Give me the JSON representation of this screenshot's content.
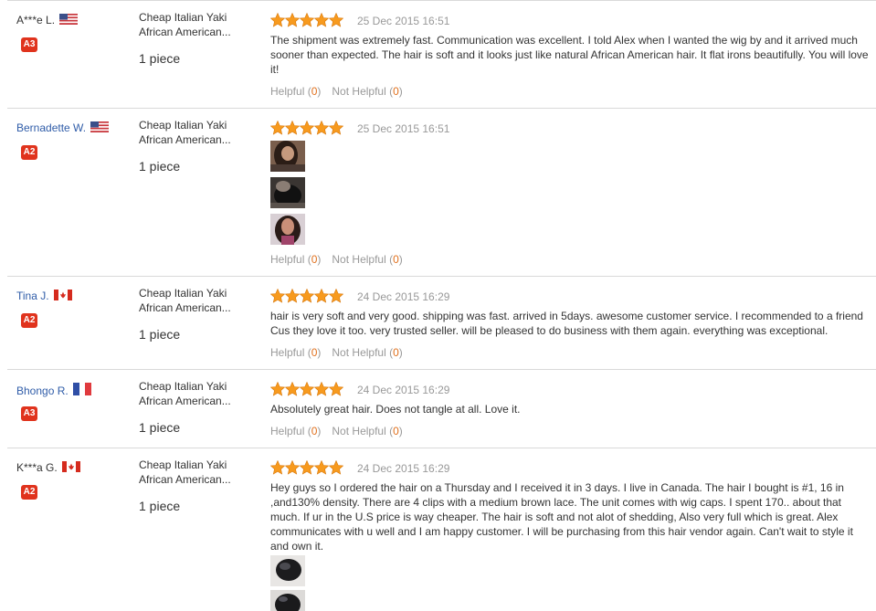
{
  "common": {
    "product_line1": "Cheap Italian Yaki",
    "product_line2": "African American...",
    "quantity": "1 piece",
    "helpful_label": "Helpful",
    "not_helpful_label": "Not Helpful",
    "star_color": "#f79a1e"
  },
  "reviews": [
    {
      "user": "A***e L.",
      "country": "US",
      "level": "A3",
      "rating": 5,
      "date": "25 Dec 2015 16:51",
      "text": "The shipment was extremely fast. Communication was excellent. I told Alex when I wanted the wig by and it arrived much sooner than expected. The hair is soft and it looks just like natural African American hair. It flat irons beautifully. You will love it!",
      "helpful": "0",
      "not_helpful": "0"
    },
    {
      "user": "Bernadette W.",
      "country": "US",
      "level": "A2",
      "rating": 5,
      "date": "25 Dec 2015 16:51",
      "text": "",
      "helpful": "0",
      "not_helpful": "0"
    },
    {
      "user": "Tina J.",
      "country": "CA",
      "level": "A2",
      "rating": 5,
      "date": "24 Dec 2015 16:29",
      "text": "hair is very soft and very good. shipping was fast. arrived in 5days. awesome customer service. I recommended to a friend Cus they love it too. very trusted seller. will be pleased to do business with them again. everything was exceptional.",
      "helpful": "0",
      "not_helpful": "0"
    },
    {
      "user": "Bhongo R.",
      "country": "FR",
      "level": "A3",
      "rating": 5,
      "date": "24 Dec 2015 16:29",
      "text": "Absolutely great hair. Does not tangle at all. Love it.",
      "helpful": "0",
      "not_helpful": "0"
    },
    {
      "user": "K***a G.",
      "country": "CA",
      "level": "A2",
      "rating": 5,
      "date": "24 Dec 2015 16:29",
      "text": "Hey guys so I ordered the hair on a Thursday and I received it in 3 days. I live in Canada. The hair I bought is #1, 16 in ,and130% density. There are 4 clips with a medium brown lace. The unit comes with wig caps. I spent 170.. about that much. If ur in the U.S price is way cheaper. The hair is soft and not alot of shedding, Also very full which is great. Alex communicates with u well and I am happy customer. I will be purchasing from this hair vendor again. Can't wait to style it and own it.",
      "helpful": "",
      "not_helpful": ""
    }
  ]
}
